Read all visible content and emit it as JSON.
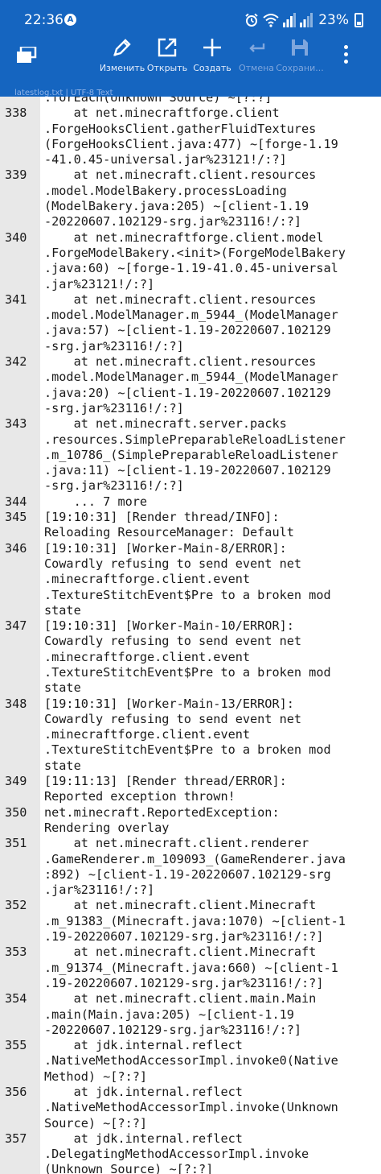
{
  "status_bar": {
    "time": "22:36",
    "battery": "23%",
    "app_icon_letter": "A"
  },
  "toolbar": {
    "edit_label": "Изменить",
    "open_label": "Открыть",
    "create_label": "Создать",
    "undo_label": "Отмена",
    "save_label": "Сохрани...",
    "menu_icon": "layers-icon",
    "more_icon": "more-vertical-icon"
  },
  "file_info": "latestlog.txt  |  UTF-8  Text",
  "colors": {
    "primary": "#1565c0",
    "gutter": "#e8e8e8",
    "text": "#1a1a1a"
  },
  "lines": [
    {
      "n": "",
      "t": ".forEach(Unknown Source) ~[?:?]"
    },
    {
      "n": "338",
      "t": "    at net.minecraftforge.client"
    },
    {
      "n": "",
      "t": ".ForgeHooksClient.gatherFluidTextures"
    },
    {
      "n": "",
      "t": "(ForgeHooksClient.java:477) ~[forge-1.19"
    },
    {
      "n": "",
      "t": "-41.0.45-universal.jar%23121!/:?]"
    },
    {
      "n": "339",
      "t": "    at net.minecraft.client.resources"
    },
    {
      "n": "",
      "t": ".model.ModelBakery.processLoading"
    },
    {
      "n": "",
      "t": "(ModelBakery.java:205) ~[client-1.19"
    },
    {
      "n": "",
      "t": "-20220607.102129-srg.jar%23116!/:?]"
    },
    {
      "n": "340",
      "t": "    at net.minecraftforge.client.model"
    },
    {
      "n": "",
      "t": ".ForgeModelBakery.<init>(ForgeModelBakery"
    },
    {
      "n": "",
      "t": ".java:60) ~[forge-1.19-41.0.45-universal"
    },
    {
      "n": "",
      "t": ".jar%23121!/:?]"
    },
    {
      "n": "341",
      "t": "    at net.minecraft.client.resources"
    },
    {
      "n": "",
      "t": ".model.ModelManager.m_5944_(ModelManager"
    },
    {
      "n": "",
      "t": ".java:57) ~[client-1.19-20220607.102129"
    },
    {
      "n": "",
      "t": "-srg.jar%23116!/:?]"
    },
    {
      "n": "342",
      "t": "    at net.minecraft.client.resources"
    },
    {
      "n": "",
      "t": ".model.ModelManager.m_5944_(ModelManager"
    },
    {
      "n": "",
      "t": ".java:20) ~[client-1.19-20220607.102129"
    },
    {
      "n": "",
      "t": "-srg.jar%23116!/:?]"
    },
    {
      "n": "343",
      "t": "    at net.minecraft.server.packs"
    },
    {
      "n": "",
      "t": ".resources.SimplePreparableReloadListener"
    },
    {
      "n": "",
      "t": ".m_10786_(SimplePreparableReloadListener"
    },
    {
      "n": "",
      "t": ".java:11) ~[client-1.19-20220607.102129"
    },
    {
      "n": "",
      "t": "-srg.jar%23116!/:?]"
    },
    {
      "n": "344",
      "t": "    ... 7 more"
    },
    {
      "n": "345",
      "t": "[19:10:31] [Render thread/INFO]:"
    },
    {
      "n": "",
      "t": "Reloading ResourceManager: Default"
    },
    {
      "n": "346",
      "t": "[19:10:31] [Worker-Main-8/ERROR]:"
    },
    {
      "n": "",
      "t": "Cowardly refusing to send event net"
    },
    {
      "n": "",
      "t": ".minecraftforge.client.event"
    },
    {
      "n": "",
      "t": ".TextureStitchEvent$Pre to a broken mod"
    },
    {
      "n": "",
      "t": "state"
    },
    {
      "n": "347",
      "t": "[19:10:31] [Worker-Main-10/ERROR]:"
    },
    {
      "n": "",
      "t": "Cowardly refusing to send event net"
    },
    {
      "n": "",
      "t": ".minecraftforge.client.event"
    },
    {
      "n": "",
      "t": ".TextureStitchEvent$Pre to a broken mod"
    },
    {
      "n": "",
      "t": "state"
    },
    {
      "n": "348",
      "t": "[19:10:31] [Worker-Main-13/ERROR]:"
    },
    {
      "n": "",
      "t": "Cowardly refusing to send event net"
    },
    {
      "n": "",
      "t": ".minecraftforge.client.event"
    },
    {
      "n": "",
      "t": ".TextureStitchEvent$Pre to a broken mod"
    },
    {
      "n": "",
      "t": "state"
    },
    {
      "n": "349",
      "t": "[19:11:13] [Render thread/ERROR]:"
    },
    {
      "n": "",
      "t": "Reported exception thrown!"
    },
    {
      "n": "350",
      "t": "net.minecraft.ReportedException:"
    },
    {
      "n": "",
      "t": "Rendering overlay"
    },
    {
      "n": "351",
      "t": "    at net.minecraft.client.renderer"
    },
    {
      "n": "",
      "t": ".GameRenderer.m_109093_(GameRenderer.java"
    },
    {
      "n": "",
      "t": ":892) ~[client-1.19-20220607.102129-srg"
    },
    {
      "n": "",
      "t": ".jar%23116!/:?]"
    },
    {
      "n": "352",
      "t": "    at net.minecraft.client.Minecraft"
    },
    {
      "n": "",
      "t": ".m_91383_(Minecraft.java:1070) ~[client-1"
    },
    {
      "n": "",
      "t": ".19-20220607.102129-srg.jar%23116!/:?]"
    },
    {
      "n": "353",
      "t": "    at net.minecraft.client.Minecraft"
    },
    {
      "n": "",
      "t": ".m_91374_(Minecraft.java:660) ~[client-1"
    },
    {
      "n": "",
      "t": ".19-20220607.102129-srg.jar%23116!/:?]"
    },
    {
      "n": "354",
      "t": "    at net.minecraft.client.main.Main"
    },
    {
      "n": "",
      "t": ".main(Main.java:205) ~[client-1.19"
    },
    {
      "n": "",
      "t": "-20220607.102129-srg.jar%23116!/:?]"
    },
    {
      "n": "355",
      "t": "    at jdk.internal.reflect"
    },
    {
      "n": "",
      "t": ".NativeMethodAccessorImpl.invoke0(Native"
    },
    {
      "n": "",
      "t": "Method) ~[?:?]"
    },
    {
      "n": "356",
      "t": "    at jdk.internal.reflect"
    },
    {
      "n": "",
      "t": ".NativeMethodAccessorImpl.invoke(Unknown"
    },
    {
      "n": "",
      "t": "Source) ~[?:?]"
    },
    {
      "n": "357",
      "t": "    at jdk.internal.reflect"
    },
    {
      "n": "",
      "t": ".DelegatingMethodAccessorImpl.invoke"
    },
    {
      "n": "",
      "t": "(Unknown Source) ~[?:?]"
    }
  ]
}
